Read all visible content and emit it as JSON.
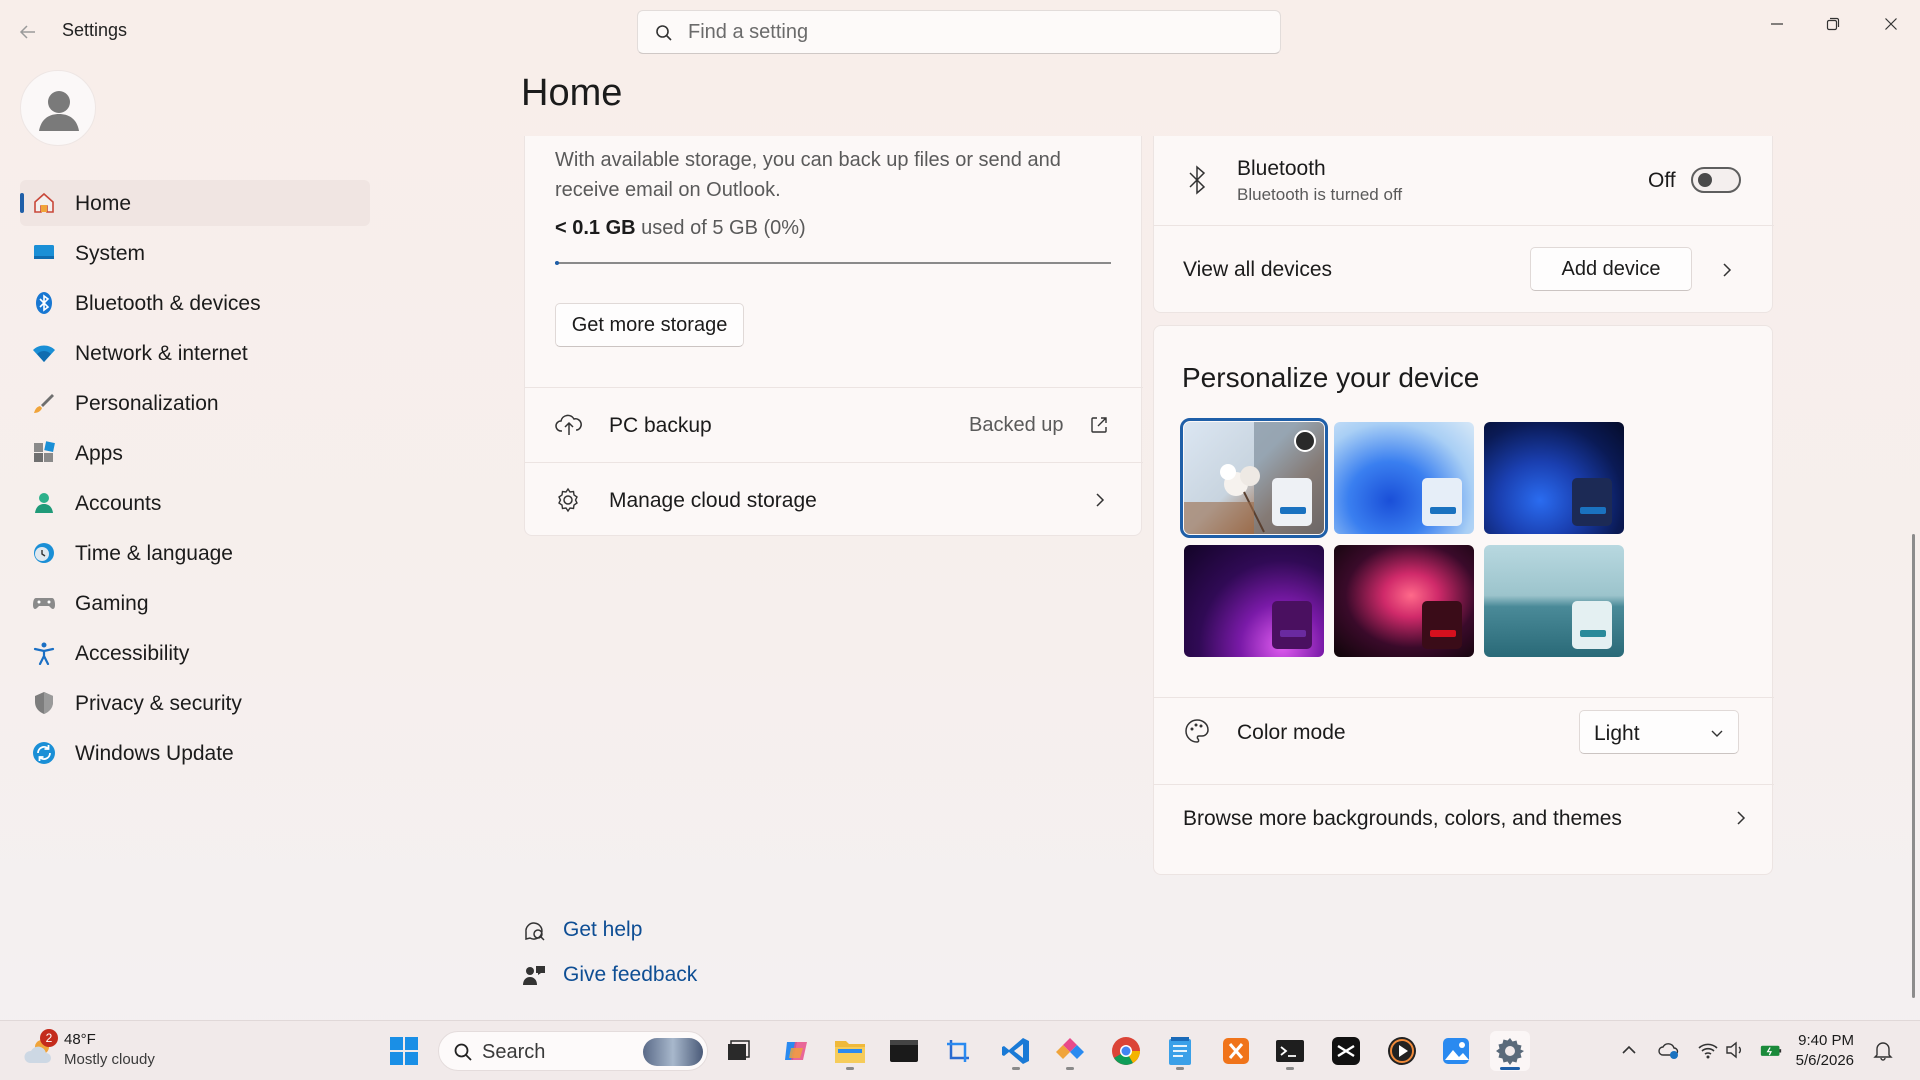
{
  "window": {
    "title": "Settings",
    "search_placeholder": "Find a setting"
  },
  "sidebar": {
    "items": [
      {
        "label": "Home",
        "icon": "home-icon",
        "active": true
      },
      {
        "label": "System",
        "icon": "system-icon"
      },
      {
        "label": "Bluetooth & devices",
        "icon": "bluetooth-icon"
      },
      {
        "label": "Network & internet",
        "icon": "wifi-icon"
      },
      {
        "label": "Personalization",
        "icon": "brush-icon"
      },
      {
        "label": "Apps",
        "icon": "apps-icon"
      },
      {
        "label": "Accounts",
        "icon": "accounts-icon"
      },
      {
        "label": "Time & language",
        "icon": "clock-globe-icon"
      },
      {
        "label": "Gaming",
        "icon": "gamepad-icon"
      },
      {
        "label": "Accessibility",
        "icon": "accessibility-icon"
      },
      {
        "label": "Privacy & security",
        "icon": "shield-icon"
      },
      {
        "label": "Windows Update",
        "icon": "update-icon"
      }
    ]
  },
  "page": {
    "title": "Home"
  },
  "storage": {
    "description": "With available storage, you can back up files or send and receive email on Outlook.",
    "used": "< 0.1 GB",
    "used_suffix": "used of 5 GB (0%)",
    "progress_percent": 0,
    "get_more_label": "Get more storage",
    "pc_backup_label": "PC backup",
    "pc_backup_status": "Backed up",
    "manage_label": "Manage cloud storage"
  },
  "devices": {
    "bluetooth_title": "Bluetooth",
    "bluetooth_subtitle": "Bluetooth is turned off",
    "bluetooth_state": "Off",
    "view_all_label": "View all devices",
    "add_device_label": "Add device"
  },
  "personalize": {
    "title": "Personalize your device",
    "themes": [
      {
        "name": "theme-cotton",
        "selected": true
      },
      {
        "name": "theme-bloom-light"
      },
      {
        "name": "theme-bloom-dark"
      },
      {
        "name": "theme-glow"
      },
      {
        "name": "theme-flow"
      },
      {
        "name": "theme-sunrise-lake"
      }
    ],
    "color_mode_label": "Color mode",
    "color_mode_value": "Light",
    "browse_label": "Browse more backgrounds, colors, and themes"
  },
  "help": {
    "get_help": "Get help",
    "give_feedback": "Give feedback"
  },
  "taskbar": {
    "weather_temp": "48°F",
    "weather_condition": "Mostly cloudy",
    "weather_badge": "2",
    "search_label": "Search",
    "time": "9:40 PM",
    "date": "5/6/2026"
  },
  "colors": {
    "accent": "#1f5fa8",
    "link": "#0e4e94"
  }
}
